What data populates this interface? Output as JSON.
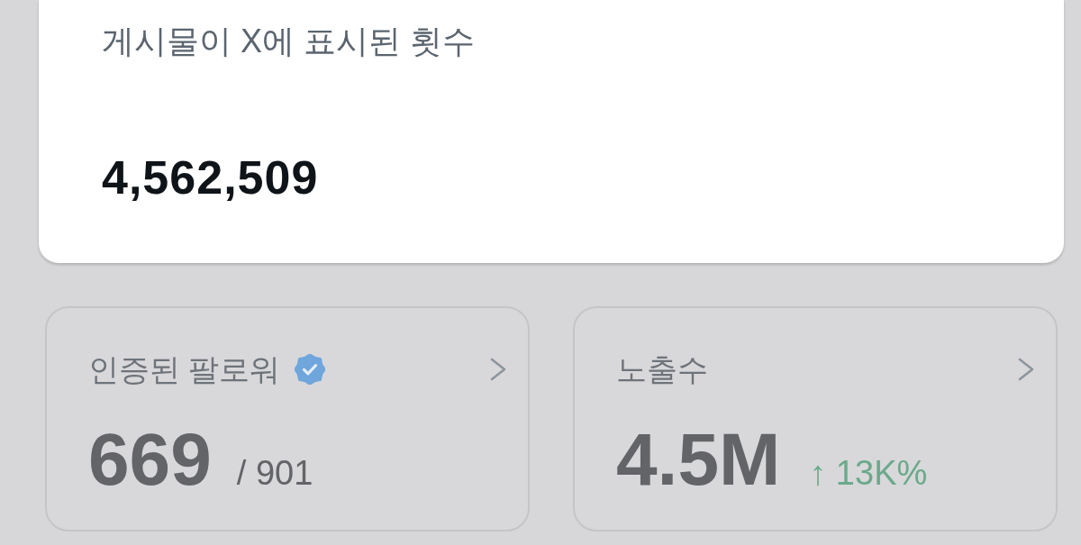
{
  "post_card": {
    "title": "게시물이 X에 표시된 횟수",
    "value": "4,562,509"
  },
  "stat_cards": [
    {
      "kind": "verified_followers",
      "label": "인증된 팔로워",
      "verified": true,
      "value": "669",
      "total": "/ 901"
    },
    {
      "kind": "impressions",
      "label": "노출수",
      "verified": false,
      "value": "4.5M",
      "change": {
        "increase": true,
        "text": "↑ 13K%"
      }
    }
  ]
}
